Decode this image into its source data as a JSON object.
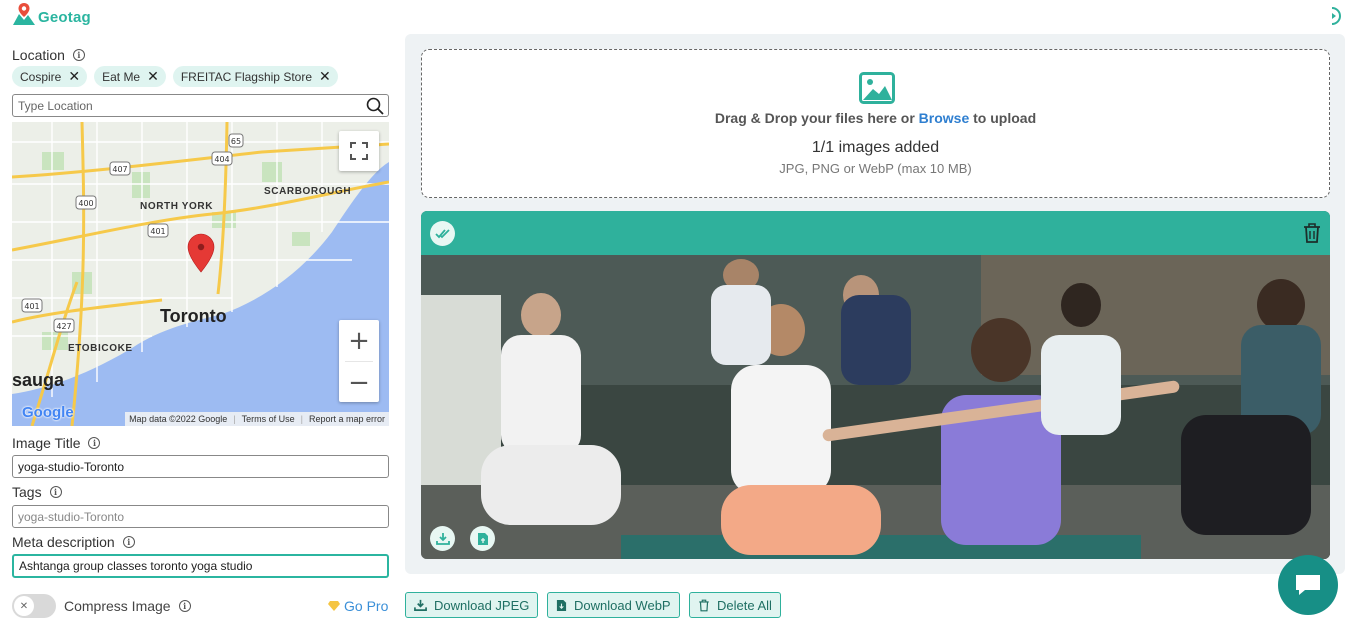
{
  "app": {
    "name": "Geotag"
  },
  "location": {
    "label": "Location",
    "chips": [
      {
        "label": "Cospire"
      },
      {
        "label": "Eat Me"
      },
      {
        "label": "FREITAC Flagship Store"
      }
    ],
    "search_placeholder": "Type Location"
  },
  "map": {
    "labels": {
      "north_york": "NORTH YORK",
      "scarborough": "SCARBOROUGH",
      "etobicoke": "ETOBICOKE",
      "city": "Toronto",
      "mississauga": "sauga"
    },
    "highways": [
      "407",
      "404",
      "65",
      "400",
      "401",
      "401",
      "427"
    ],
    "google_logo": "Google",
    "footer": {
      "map_data": "Map data ©2022 Google",
      "terms": "Terms of Use",
      "report": "Report a map error"
    }
  },
  "image_title": {
    "label": "Image Title",
    "value": "yoga-studio-Toronto"
  },
  "tags": {
    "label": "Tags",
    "placeholder": "yoga-studio-Toronto"
  },
  "meta": {
    "label": "Meta description",
    "value": "Ashtanga group classes toronto yoga studio"
  },
  "compress": {
    "label": "Compress Image",
    "enabled": false
  },
  "go_pro": {
    "label": "Go Pro"
  },
  "dropzone": {
    "text_before": "Drag & Drop your files here or ",
    "browse": "Browse",
    "text_after": " to upload",
    "count": "1/1 images added",
    "hint": "JPG, PNG or WebP (max 10 MB)"
  },
  "buttons": {
    "download_jpeg": "Download JPEG",
    "download_webp": "Download WebP",
    "delete_all": "Delete All"
  },
  "colors": {
    "accent": "#2fb19c",
    "link": "#2f7fd0",
    "chat": "#178f86"
  }
}
